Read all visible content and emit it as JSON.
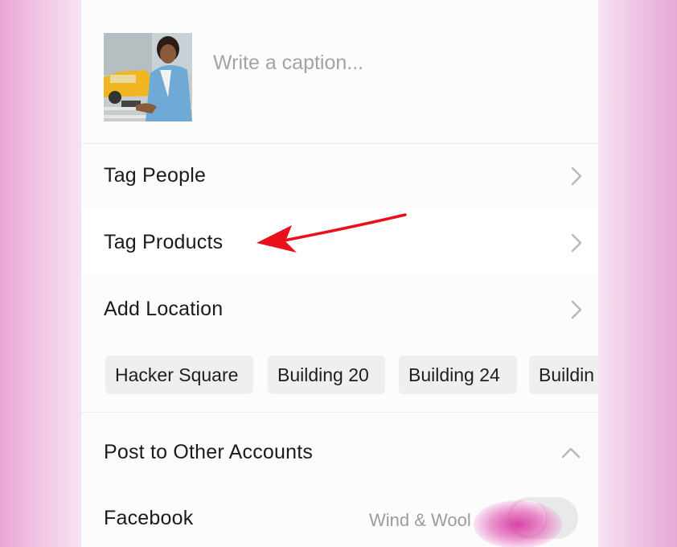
{
  "caption": {
    "placeholder": "Write a caption..."
  },
  "rows": {
    "tag_people": "Tag People",
    "tag_products": "Tag Products",
    "add_location": "Add Location"
  },
  "location_suggestions": [
    "Hacker Square",
    "Building 20",
    "Building 24",
    "Buildin"
  ],
  "other_accounts": {
    "header": "Post to Other Accounts",
    "facebook": {
      "label": "Facebook",
      "account": "Wind & Wool",
      "enabled": false
    }
  },
  "icons": {
    "row_chevron": "chevron-right-icon",
    "section_chevron": "chevron-up-icon",
    "annotation": "red-arrow-icon"
  },
  "colors": {
    "annotation_arrow": "#e8101a",
    "side_background": "#eab0dc",
    "chip_background": "#efefef"
  }
}
